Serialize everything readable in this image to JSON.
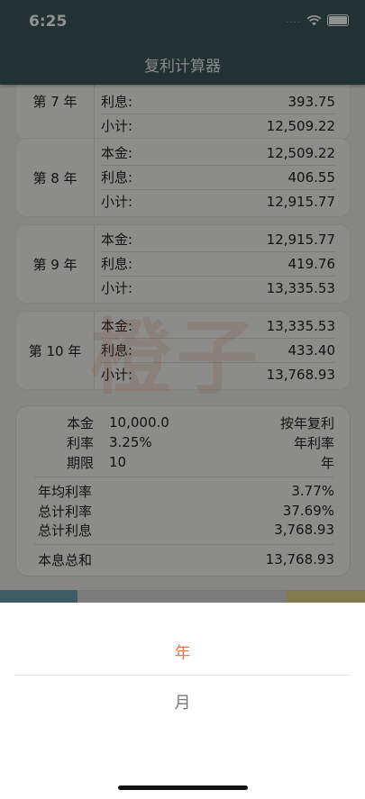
{
  "status": {
    "time": "6:25",
    "dots": "....",
    "wifi_icon": "wifi-icon",
    "battery_icon": "battery-icon"
  },
  "nav": {
    "title": "复利计算器"
  },
  "watermark": "橙子",
  "years": [
    {
      "label": "第 7 年",
      "rows": [
        {
          "k": "利息:",
          "v": "393.75"
        },
        {
          "k": "小计:",
          "v": "12,509.22"
        }
      ]
    },
    {
      "label": "第 8 年",
      "rows": [
        {
          "k": "本金:",
          "v": "12,509.22"
        },
        {
          "k": "利息:",
          "v": "406.55"
        },
        {
          "k": "小计:",
          "v": "12,915.77"
        }
      ]
    },
    {
      "label": "第 9 年",
      "rows": [
        {
          "k": "本金:",
          "v": "12,915.77"
        },
        {
          "k": "利息:",
          "v": "419.76"
        },
        {
          "k": "小计:",
          "v": "13,335.53"
        }
      ]
    },
    {
      "label": "第 10 年",
      "rows": [
        {
          "k": "本金:",
          "v": "13,335.53"
        },
        {
          "k": "利息:",
          "v": "433.40"
        },
        {
          "k": "小计:",
          "v": "13,768.93"
        }
      ]
    }
  ],
  "summary": {
    "principal_label": "本金",
    "principal_value": "10,000.0",
    "compound_mode": "按年复利",
    "rate_label": "利率",
    "rate_value": "3.25%",
    "rate_unit": "年利率",
    "term_label": "期限",
    "term_value": "10",
    "term_unit": "年",
    "avg_rate_label": "年均利率",
    "avg_rate_value": "3.77%",
    "total_rate_label": "总计利率",
    "total_rate_value": "37.69%",
    "total_interest_label": "总计利息",
    "total_interest_value": "3,768.93",
    "total_label": "本息总和",
    "total_value": "13,768.93"
  },
  "colors": {
    "nav_bg": "#3c5759",
    "accent": "#ea7b47",
    "peek_left": "#6fa3b0",
    "peek_mid": "#d8d8d8",
    "peek_right": "#e6d98a"
  },
  "sheet": {
    "options": [
      "年",
      "月"
    ],
    "selected": "年"
  }
}
